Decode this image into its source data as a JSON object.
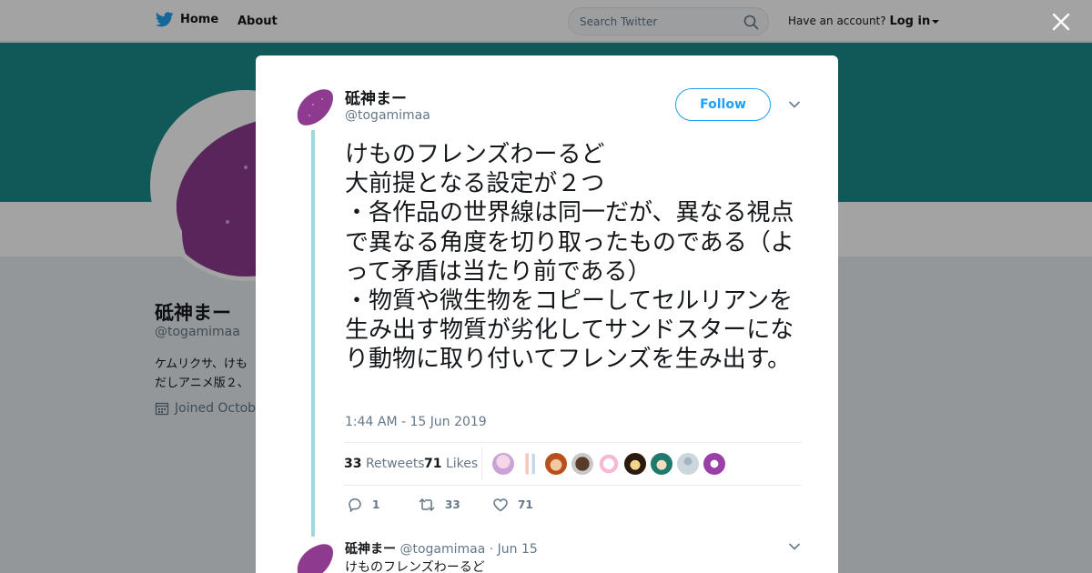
{
  "nav": {
    "home_label": "Home",
    "about_label": "About",
    "search_placeholder": "Search Twitter",
    "account_prompt": "Have an account?",
    "login_label": "Log in"
  },
  "profile": {
    "name": "砥神まー",
    "handle": "@togamimaa",
    "bio_line1": "ケムリクサ、けも",
    "bio_line2": "だしアニメ版２、",
    "joined": "Joined Octobe"
  },
  "tweet": {
    "author_name": "砥神まー",
    "author_handle": "@togamimaa",
    "follow_label": "Follow",
    "text": "けものフレンズわーるど\n大前提となる設定が２つ\n・各作品の世界線は同一だが、異なる視点で異なる角度を切り取ったものである（よって矛盾は当たり前である）\n・物質や微生物をコピーしてセルリアンを生み出す物質が劣化してサンドスターになり動物に取り付いてフレンズを生み出す。",
    "timestamp": "1:44 AM - 15 Jun 2019",
    "retweets_count": "33",
    "retweets_label": "Retweets",
    "likes_count": "71",
    "likes_label": "Likes",
    "reply_count": "1",
    "retweet_action_count": "33",
    "like_action_count": "71"
  },
  "reply_tweet": {
    "name": "砥神まー",
    "handle": "@togamimaa",
    "date": "· Jun 15",
    "text": "けものフレンズわーるど"
  },
  "icons": {
    "brand": "twitter-bird-icon",
    "search": "search-icon",
    "close": "close-icon",
    "chevron": "chevron-down-icon",
    "calendar": "calendar-icon",
    "reply": "reply-icon",
    "retweet": "retweet-icon",
    "like": "heart-icon"
  },
  "colors": {
    "accent": "#1da1f2",
    "banner": "#1a8c8a",
    "thread_line": "#9fd9e0",
    "avatar_purple": "#8e3a8f"
  }
}
